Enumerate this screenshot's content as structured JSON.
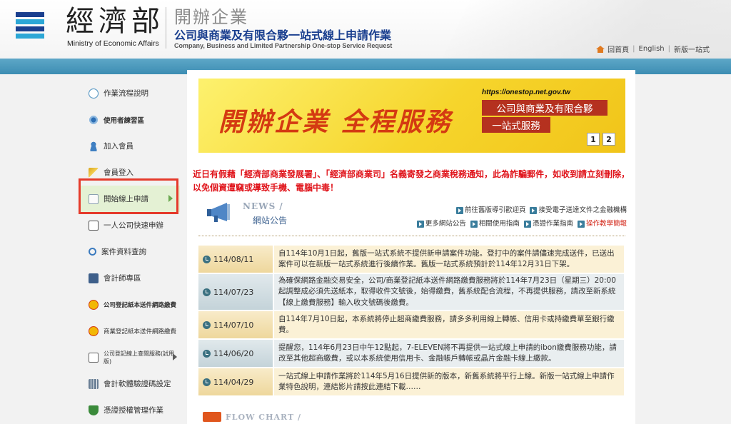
{
  "header": {
    "ministry_cn": "經濟部",
    "ministry_en": "Ministry of Economic Affairs",
    "service_title": "開辦企業",
    "service_subtitle": "公司與商業及有限合夥一站式線上申請作業",
    "service_en": "Company, Business and Limited Partnership One-stop Service Request",
    "links": [
      "回首頁",
      "English",
      "新版一站式"
    ],
    "link_separator": "|"
  },
  "sidebar": {
    "items": [
      {
        "label": "作業流程說明",
        "icon": "speech-bubble-icon"
      },
      {
        "label": "使用者練習區",
        "icon": "gears-icon"
      },
      {
        "label": "加入會員",
        "icon": "user-icon"
      },
      {
        "label": "會員登入",
        "icon": "key-icon"
      },
      {
        "label": "開始線上申請",
        "icon": "document-icon"
      },
      {
        "label": "一人公司快速申辦",
        "icon": "edit-icon"
      },
      {
        "label": "案件資料查詢",
        "icon": "magnifier-icon"
      },
      {
        "label": "會計師專區",
        "icon": "ledger-icon"
      },
      {
        "label": "公司登記紙本送件網路繳費",
        "icon": "dollar-coin-icon"
      },
      {
        "label": "商業登記紙本送件網路繳費",
        "icon": "dollar-coin-icon"
      },
      {
        "label": "公司登記線上查閱服務(試用版)",
        "icon": "document-icon"
      },
      {
        "label": "會計軟體驗證碼設定",
        "icon": "calculator-icon"
      },
      {
        "label": "憑證授權管理作業",
        "icon": "shield-icon"
      }
    ]
  },
  "banner": {
    "headline": "開辦企業 全程服務",
    "url": "https://onestop.net.gov.tw",
    "tag1": "公司與商業及有限合夥",
    "tag2": "一站式服務",
    "pages": [
      "1",
      "2"
    ]
  },
  "warning": "近日有假藉「經濟部商業發展署」、「經濟部商業司」名義寄發之商業稅務通知，此為詐騙郵件，如收到請立刻刪除，以免個資遭竊或導致手機、電腦中毒！",
  "news": {
    "title_en": "NEWS /",
    "title_cn": "網站公告",
    "links_row1": [
      {
        "label": "前往舊版導引歡迎頁",
        "red": false
      },
      {
        "label": "接受電子送達文件之金融機構",
        "red": false
      }
    ],
    "links_row2": [
      {
        "label": "更多網站公告",
        "red": false
      },
      {
        "label": "相關使用指南",
        "red": false
      },
      {
        "label": "憑證作業指南",
        "red": false
      },
      {
        "label": "操作教學簡報",
        "red": true
      }
    ],
    "items": [
      {
        "date": "114/08/11",
        "text": "自114年10月1日起，舊版一站式系統不提供新申請案件功能。登打中的案件請儘速完成送件，已送出案件可以在新版一站式系統進行後續作業。舊版一站式系統預計於114年12月31日下架。"
      },
      {
        "date": "114/07/23",
        "text": "為確保網路金融交易安全，公司/商業登記紙本送件網路繳費服務將於114年7月23日（星期三）20:00起調整成必須先送紙本，取得收件文號後，始得繳費，舊系統配合流程，不再提供服務，請改至新系統【線上繳費服務】輸入收文號碼後繳費。"
      },
      {
        "date": "114/07/10",
        "text": "自114年7月10日起，本系統將停止超商繳費服務，請多多利用線上轉帳、信用卡或持繳費單至銀行繳費。"
      },
      {
        "date": "114/06/20",
        "text": "提醒您，114年6月23日中午12點起，7-ELEVEN將不再提供一站式線上申請的ibon繳費服務功能，請改至其他超商繳費，或以本系統使用信用卡、金融帳戶轉帳或晶片金融卡線上繳款。"
      },
      {
        "date": "114/04/29",
        "text": "一站式線上申請作業將於114年5月16日提供新的版本，新舊系統將平行上線。新版一站式線上申請作業特色說明，連結影片請按此連結下載……"
      }
    ]
  },
  "flow": {
    "title_en": "FLOW CHART /"
  },
  "colors": {
    "accent_blue": "#1a3f8f",
    "band": "#3d8db3",
    "warning_red": "#e0141b",
    "highlight_red": "#e53a2b",
    "banner_red": "#b5311f"
  }
}
